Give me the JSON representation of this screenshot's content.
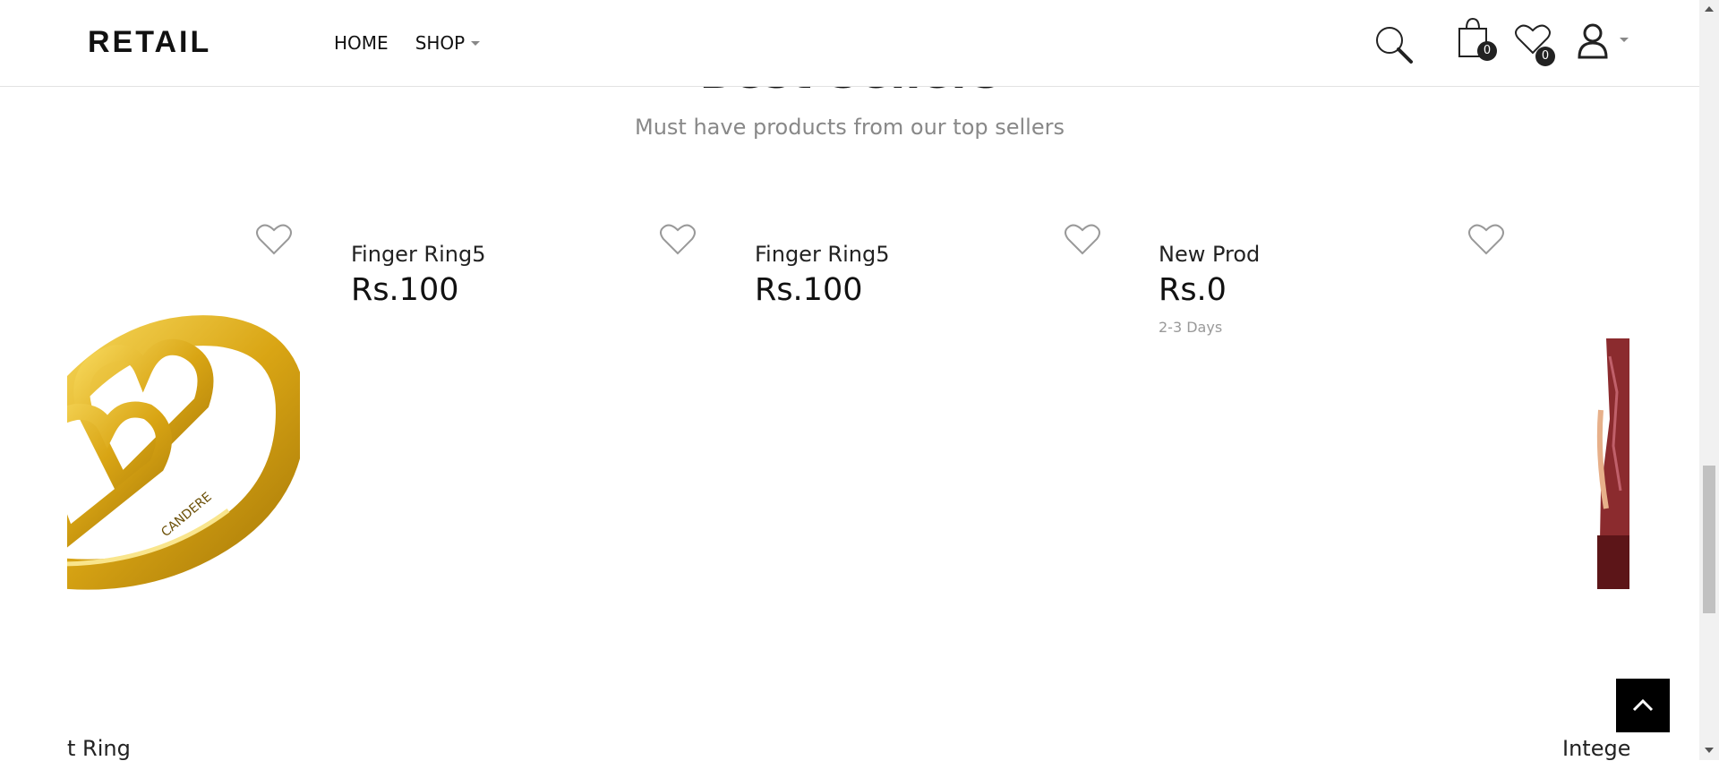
{
  "header": {
    "logo": "RETAIL",
    "nav": [
      {
        "label": "HOME",
        "has_dropdown": false
      },
      {
        "label": "SHOP",
        "has_dropdown": true
      }
    ],
    "cart_count": "0",
    "wishlist_count": "0",
    "icons": [
      "search-icon",
      "cart-icon",
      "wishlist-icon",
      "account-icon"
    ]
  },
  "section": {
    "title": "Best Sellers",
    "subtitle": "Must have products from our top sellers"
  },
  "products": [
    {
      "name": "Finger Ring5",
      "price": "Rs.100"
    },
    {
      "name": "Finger Ring5",
      "price": "Rs.100"
    },
    {
      "name": "New Prod",
      "price": "Rs.0",
      "delivery": "2-3 Days"
    }
  ],
  "ring_engraving": "CANDERE",
  "bottom_row": {
    "left_name": "t Ring",
    "right_name": "Integer"
  },
  "colors": {
    "accent": "#000000",
    "gold": "#d9a514",
    "muted": "#888888"
  }
}
